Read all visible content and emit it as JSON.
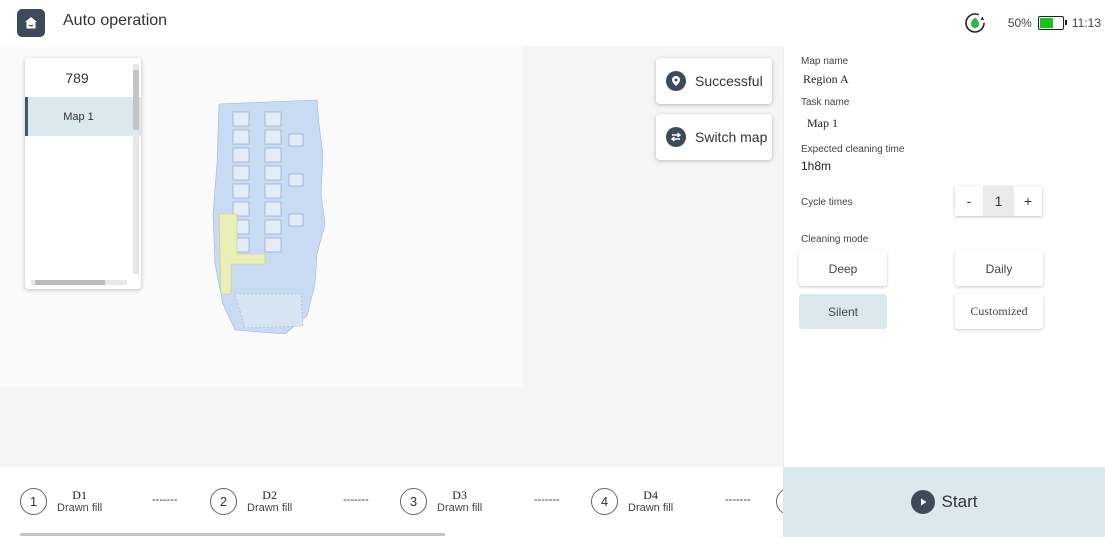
{
  "header": {
    "title": "Auto operation",
    "battery_percent": "50%",
    "battery_level": 0.55,
    "time": "11:13"
  },
  "map_list": {
    "items": [
      "789",
      "Map 1"
    ],
    "selected": "Map 1"
  },
  "actions": {
    "successful_label": "Successful",
    "switch_map_label": "Switch map"
  },
  "details": {
    "map_name_label": "Map name",
    "map_name_value": "Region A",
    "task_name_label": "Task name",
    "task_name_value": "Map 1",
    "expected_time_label": "Expected cleaning time",
    "expected_time_value": "1h8m",
    "cycle_times_label": "Cycle times",
    "cycle_times_value": "1",
    "cycle_minus": "-",
    "cycle_plus": "+",
    "cleaning_mode_label": "Cleaning mode"
  },
  "cleaning_modes": [
    {
      "label": "Deep",
      "active": false
    },
    {
      "label": "Daily",
      "active": false
    },
    {
      "label": "Silent",
      "active": true
    },
    {
      "label": "Customized",
      "active": false
    }
  ],
  "steps": [
    {
      "number": "1",
      "code": "D1",
      "desc": "Drawn fill",
      "dash": "-------"
    },
    {
      "number": "2",
      "code": "D2",
      "desc": "Drawn fill",
      "dash": "-------"
    },
    {
      "number": "3",
      "code": "D3",
      "desc": "Drawn fill",
      "dash": "-------"
    },
    {
      "number": "4",
      "code": "D4",
      "desc": "Drawn fill",
      "dash": "-------"
    }
  ],
  "start_label": "Start",
  "colors": {
    "accent_dark": "#3d4a5c",
    "active_bg": "#dbe8ee",
    "battery_green": "#19c31f",
    "status_green": "#2db84d"
  },
  "icons": {
    "home": "home-icon",
    "signal": "network-status-icon",
    "location": "location-pin-icon",
    "switch": "switch-arrows-icon",
    "play": "play-icon"
  }
}
